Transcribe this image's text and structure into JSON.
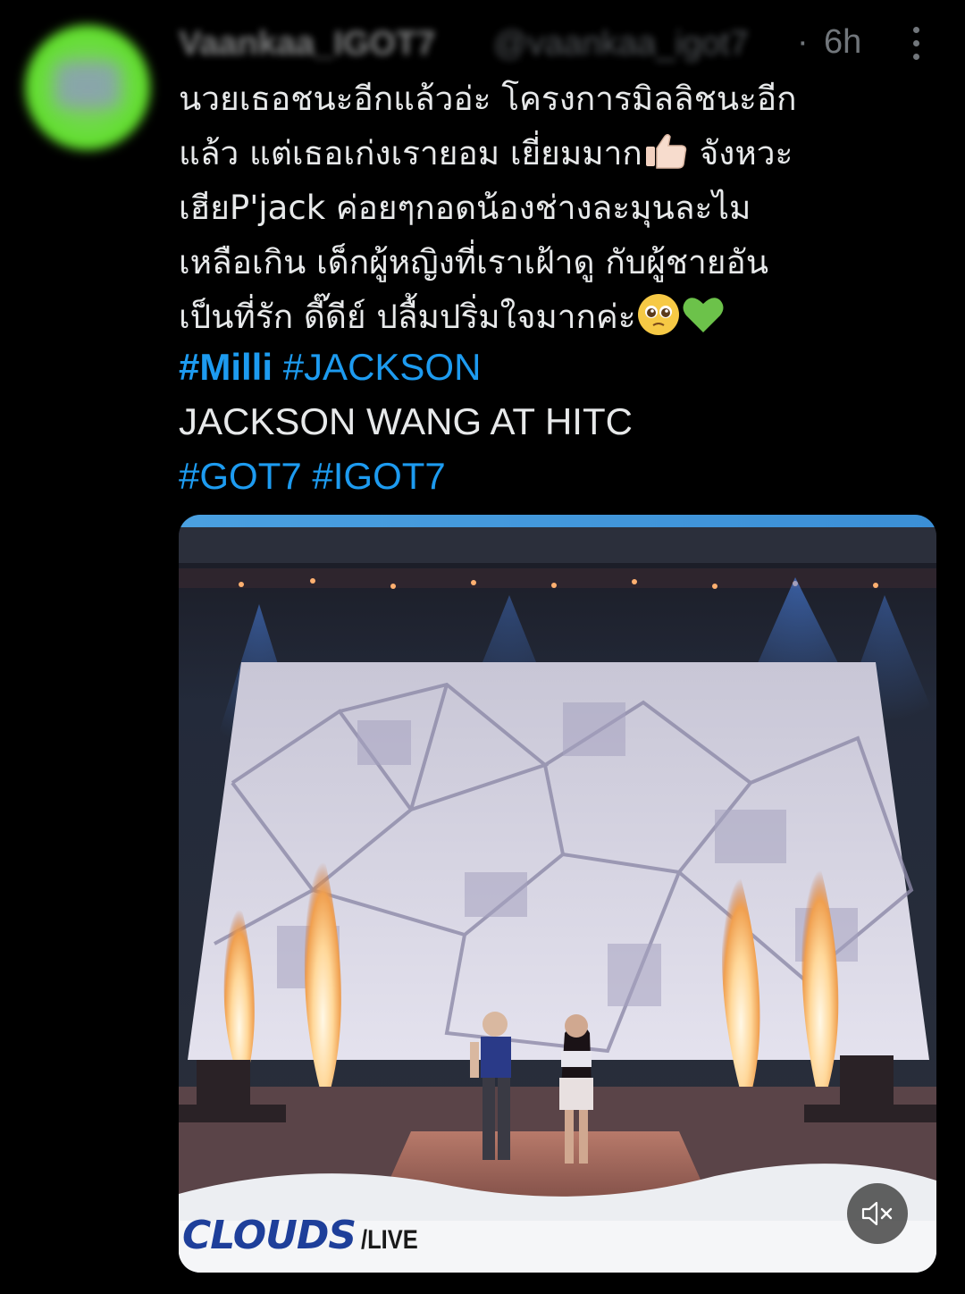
{
  "tweet": {
    "author": {
      "display_name": "Vaankaa_IGOT7",
      "handle": "@vaankaa_igot7"
    },
    "separator": "·",
    "timestamp": "6h",
    "body_lines": [
      "นวยเธอชนะอีกแล้วอ่ะ โครงการมิลลิชนะอีก",
      "แล้ว แต่เธอเก่งเรายอม เยี่ยมมาก",
      "จังหวะ",
      "เฮียP'jack ค่อยๆกอดน้องช่างละมุนละไม",
      "เหลือเกิน เด็กผู้หญิงที่เราเฝ้าดู กับผู้ชายอัน",
      "เป็นที่รัก ดี๊ดีย์ ปลื้มปริ่มใจมากค่ะ"
    ],
    "hashtags_line1": [
      "#Milli",
      "#JACKSON"
    ],
    "title_line": "JACKSON WANG AT HITC",
    "hashtags_line2": [
      "#GOT7",
      "#IGOT7"
    ]
  },
  "media": {
    "brand_name": "CLOUDS",
    "brand_suffix": "/LIVE",
    "mute_icon": "speaker-muted-icon"
  },
  "icons": {
    "more": "more-vertical-icon",
    "emoji_1": "thumbs-up-emoji",
    "emoji_2": "pleading-face-emoji",
    "emoji_3": "green-heart-emoji"
  },
  "colors": {
    "background": "#000000",
    "text": "#e7e9ea",
    "secondary": "#71767b",
    "link": "#1d9bf0",
    "avatar": "#5fe028"
  }
}
